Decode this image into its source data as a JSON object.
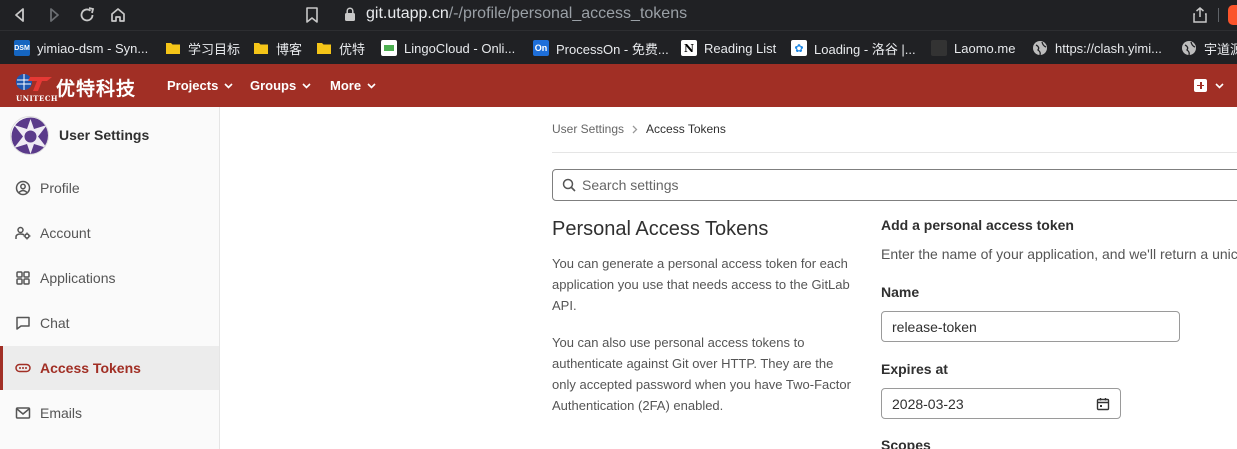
{
  "browser": {
    "url_host": "git.utapp.cn",
    "url_path": "/-/profile/personal_access_tokens",
    "bookmarks": [
      {
        "icon": "dsm-icon",
        "label": "yimiao-dsm - Syn..."
      },
      {
        "icon": "folder-icon",
        "label": "学习目标"
      },
      {
        "icon": "folder-icon",
        "label": "博客"
      },
      {
        "icon": "folder-icon",
        "label": "优特"
      },
      {
        "icon": "lingocloud-icon",
        "label": "LingoCloud - Onli..."
      },
      {
        "icon": "processon-icon",
        "label": "ProcessOn - 免费..."
      },
      {
        "icon": "notion-icon",
        "label": "Reading List"
      },
      {
        "icon": "luogu-icon",
        "label": "Loading - 洛谷 |..."
      },
      {
        "icon": "laomo-icon",
        "label": "Laomo.me"
      },
      {
        "icon": "globe-icon",
        "label": "https://clash.yimi..."
      },
      {
        "icon": "globe-icon",
        "label": "宇道源"
      }
    ],
    "bookmark_icon_text": {
      "dsm": "DSM",
      "on": "On",
      "notion": "N",
      "luogu": "✿"
    }
  },
  "header": {
    "brand_name": "优特科技",
    "brand_sub": "UNITECH",
    "nav": [
      "Projects",
      "Groups",
      "More"
    ],
    "accent_color": "#a12f25"
  },
  "sidebar": {
    "title": "User Settings",
    "items": [
      {
        "label": "Profile",
        "icon": "profile-icon",
        "active": false
      },
      {
        "label": "Account",
        "icon": "account-icon",
        "active": false
      },
      {
        "label": "Applications",
        "icon": "applications-icon",
        "active": false
      },
      {
        "label": "Chat",
        "icon": "chat-icon",
        "active": false
      },
      {
        "label": "Access Tokens",
        "icon": "token-icon",
        "active": true
      },
      {
        "label": "Emails",
        "icon": "email-icon",
        "active": false
      }
    ]
  },
  "breadcrumb": {
    "parent": "User Settings",
    "current": "Access Tokens"
  },
  "search": {
    "placeholder": "Search settings",
    "value": ""
  },
  "section": {
    "title": "Personal Access Tokens",
    "para1": "You can generate a personal access token for each application you use that needs access to the GitLab API.",
    "para2": "You can also use personal access tokens to authenticate against Git over HTTP. They are the only accepted password when you have Two-Factor Authentication (2FA) enabled."
  },
  "form": {
    "title": "Add a personal access token",
    "description": "Enter the name of your application, and we'll return a unic",
    "name_label": "Name",
    "name_value": "release-token",
    "expires_label": "Expires at",
    "expires_value": "2028-03-23",
    "scopes_label": "Scopes"
  }
}
